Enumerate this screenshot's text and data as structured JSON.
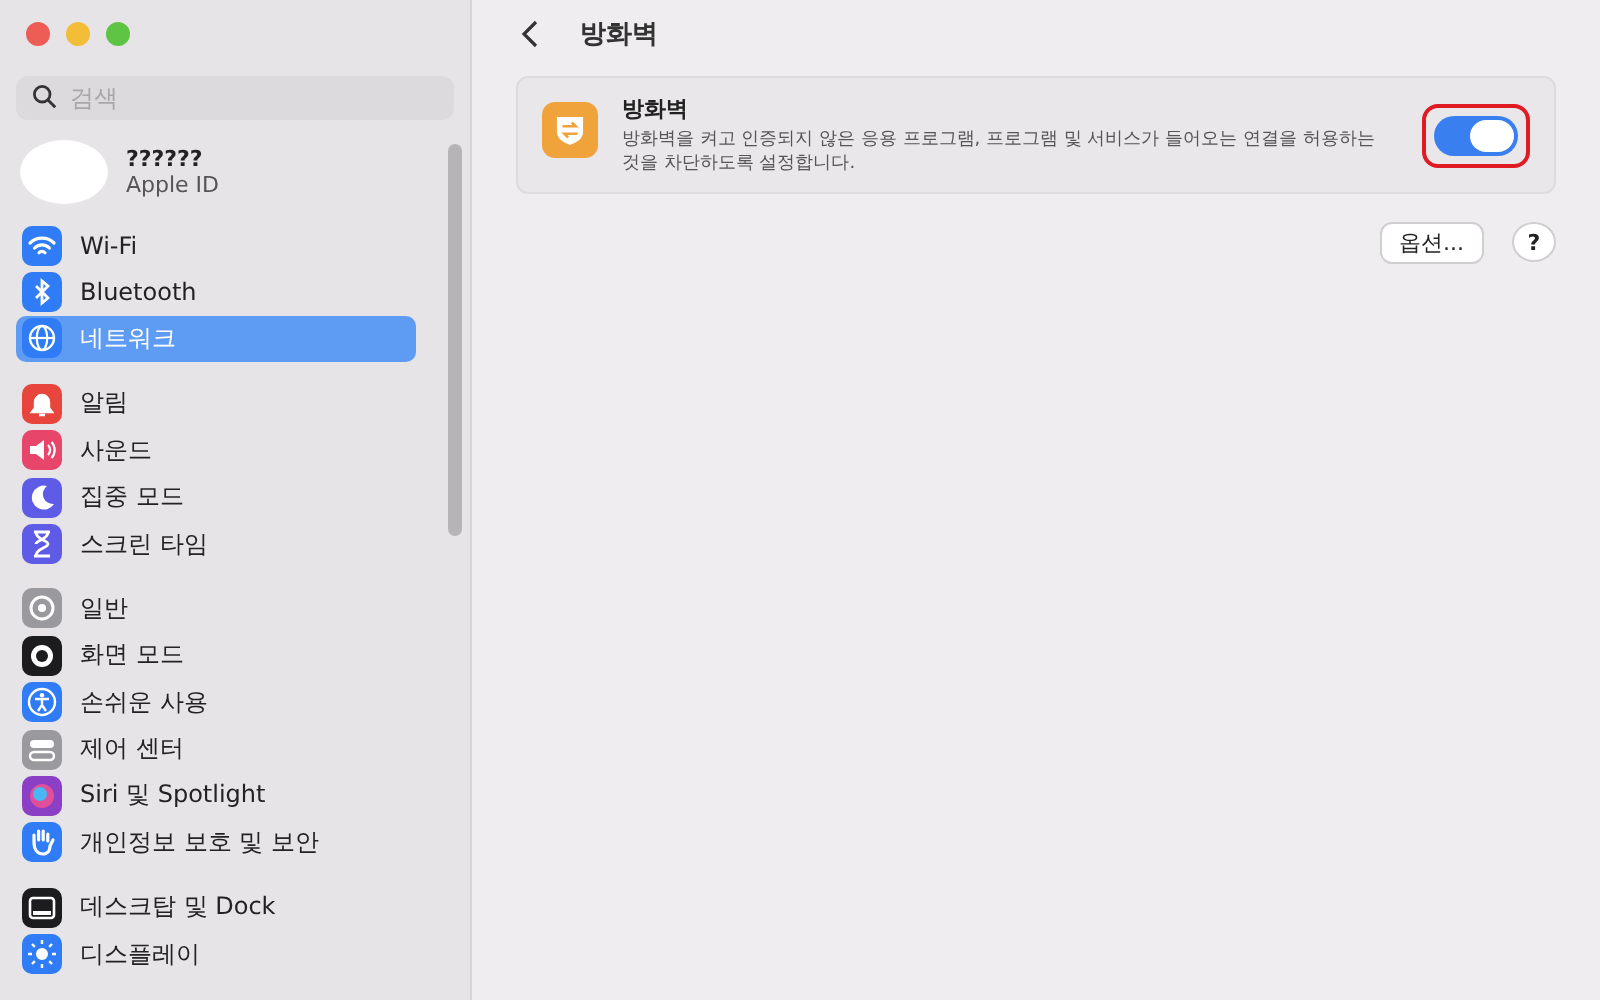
{
  "sidebar": {
    "search": {
      "placeholder": "검색"
    },
    "account": {
      "name": "??????",
      "subtitle": "Apple ID"
    },
    "groups": [
      [
        {
          "label": "Wi-Fi",
          "kind": "wifi",
          "color": "#2f7cf6",
          "selected": false
        },
        {
          "label": "Bluetooth",
          "kind": "bluetooth",
          "color": "#2f7cf6",
          "selected": false
        },
        {
          "label": "네트워크",
          "kind": "globe",
          "color": "#2f7cf6",
          "selected": true
        }
      ],
      [
        {
          "label": "알림",
          "kind": "bell",
          "color": "#e8453c",
          "selected": false
        },
        {
          "label": "사운드",
          "kind": "speaker",
          "color": "#e8456a",
          "selected": false
        },
        {
          "label": "집중 모드",
          "kind": "moon",
          "color": "#5e5ce6",
          "selected": false
        },
        {
          "label": "스크린 타임",
          "kind": "hourglass",
          "color": "#5e5ce6",
          "selected": false
        }
      ],
      [
        {
          "label": "일반",
          "kind": "gear",
          "color": "#9a9a9e",
          "selected": false
        },
        {
          "label": "화면 모드",
          "kind": "eye",
          "color": "#1c1c1e",
          "selected": false
        },
        {
          "label": "손쉬운 사용",
          "kind": "person",
          "color": "#2f7cf6",
          "selected": false
        },
        {
          "label": "제어 센터",
          "kind": "switches",
          "color": "#9a9a9e",
          "selected": false
        },
        {
          "label": "Siri 및 Spotlight",
          "kind": "orb",
          "color": "#8a3fc4",
          "selected": false
        },
        {
          "label": "개인정보 보호 및 보안",
          "kind": "hand",
          "color": "#2f7cf6",
          "selected": false
        }
      ],
      [
        {
          "label": "데스크탑 및 Dock",
          "kind": "dock",
          "color": "#1c1c1e",
          "selected": false
        },
        {
          "label": "디스플레이",
          "kind": "sun",
          "color": "#2f7cf6",
          "selected": false
        }
      ]
    ]
  },
  "page": {
    "title": "방화벽",
    "setting": {
      "title": "방화벽",
      "description": "방화벽을 켜고 인증되지 않은 응용 프로그램, 프로그램 및 서비스가 들어오는 연결을 허용하는 것을 차단하도록 설정합니다.",
      "on": true,
      "highlighted": true
    },
    "buttons": [
      {
        "label": "옵션..."
      },
      {
        "label": "?"
      }
    ]
  }
}
